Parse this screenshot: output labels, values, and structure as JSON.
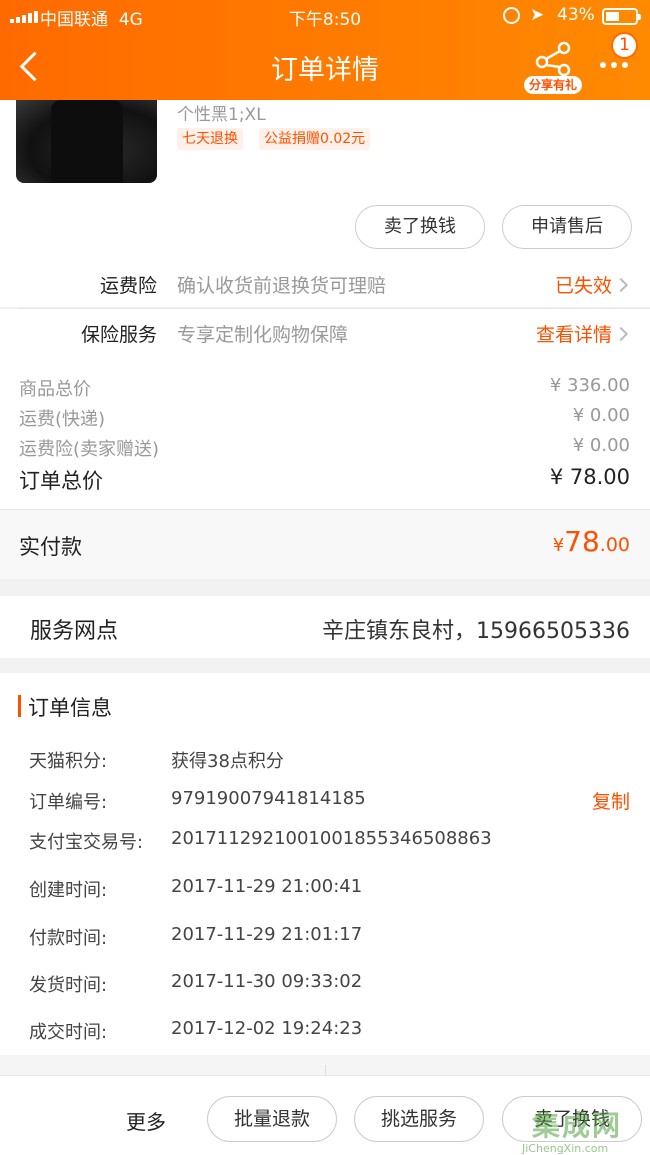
{
  "status_bar": {
    "carrier": "中国联通",
    "network": "4G",
    "time": "下午8:50",
    "battery": "43%"
  },
  "nav": {
    "title": "订单详情",
    "share_label": "分享有礼",
    "badge_count": "1"
  },
  "product": {
    "sku": "个性黑1;XL",
    "tags": [
      "七天退换",
      "公益捐赠0.02元"
    ]
  },
  "item_actions": {
    "sell_label": "卖了换钱",
    "aftersale_label": "申请售后"
  },
  "insurance": [
    {
      "name": "运费险",
      "desc": "确认收货前退换货可理赔",
      "status": "已失效"
    },
    {
      "name": "保险服务",
      "desc": "专享定制化购物保障",
      "status": "查看详情"
    }
  ],
  "price": {
    "goods_label": "商品总价",
    "goods_value": "¥ 336.00",
    "shipping_label": "运费(快递)",
    "shipping_value": "¥ 0.00",
    "ins_label": "运费险(卖家赠送)",
    "ins_value": "¥ 0.00",
    "total_label": "订单总价",
    "total_value": "¥ 78.00"
  },
  "paid": {
    "label": "实付款",
    "currency": "¥",
    "int": "78",
    "dec": ".00"
  },
  "service_point": {
    "label": "服务网点",
    "value": "辛庄镇东良村，15966505336"
  },
  "order_info": {
    "title": "订单信息",
    "copy_label": "复制",
    "rows": [
      {
        "label": "天猫积分:",
        "value": "获得38点积分"
      },
      {
        "label": "订单编号:",
        "value": "97919007941814185"
      },
      {
        "label": "支付宝交易号:",
        "value": "2017112921001001855346508863"
      },
      {
        "label": "创建时间:",
        "value": "2017-11-29 21:00:41"
      },
      {
        "label": "付款时间:",
        "value": "2017-11-29 21:01:17"
      },
      {
        "label": "发货时间:",
        "value": "2017-11-30 09:33:02"
      },
      {
        "label": "成交时间:",
        "value": "2017-12-02 19:24:23"
      }
    ]
  },
  "bottom_bar": {
    "more_label": "更多",
    "refund_label": "批量退款",
    "service_label": "挑选服务",
    "sell_label": "卖了换钱"
  },
  "watermark": {
    "text": "集成网",
    "url": "JiChengXin.com"
  },
  "colors": {
    "accent": "#ff5000",
    "header_start": "#ff6a00",
    "header_end": "#ff8a00"
  }
}
